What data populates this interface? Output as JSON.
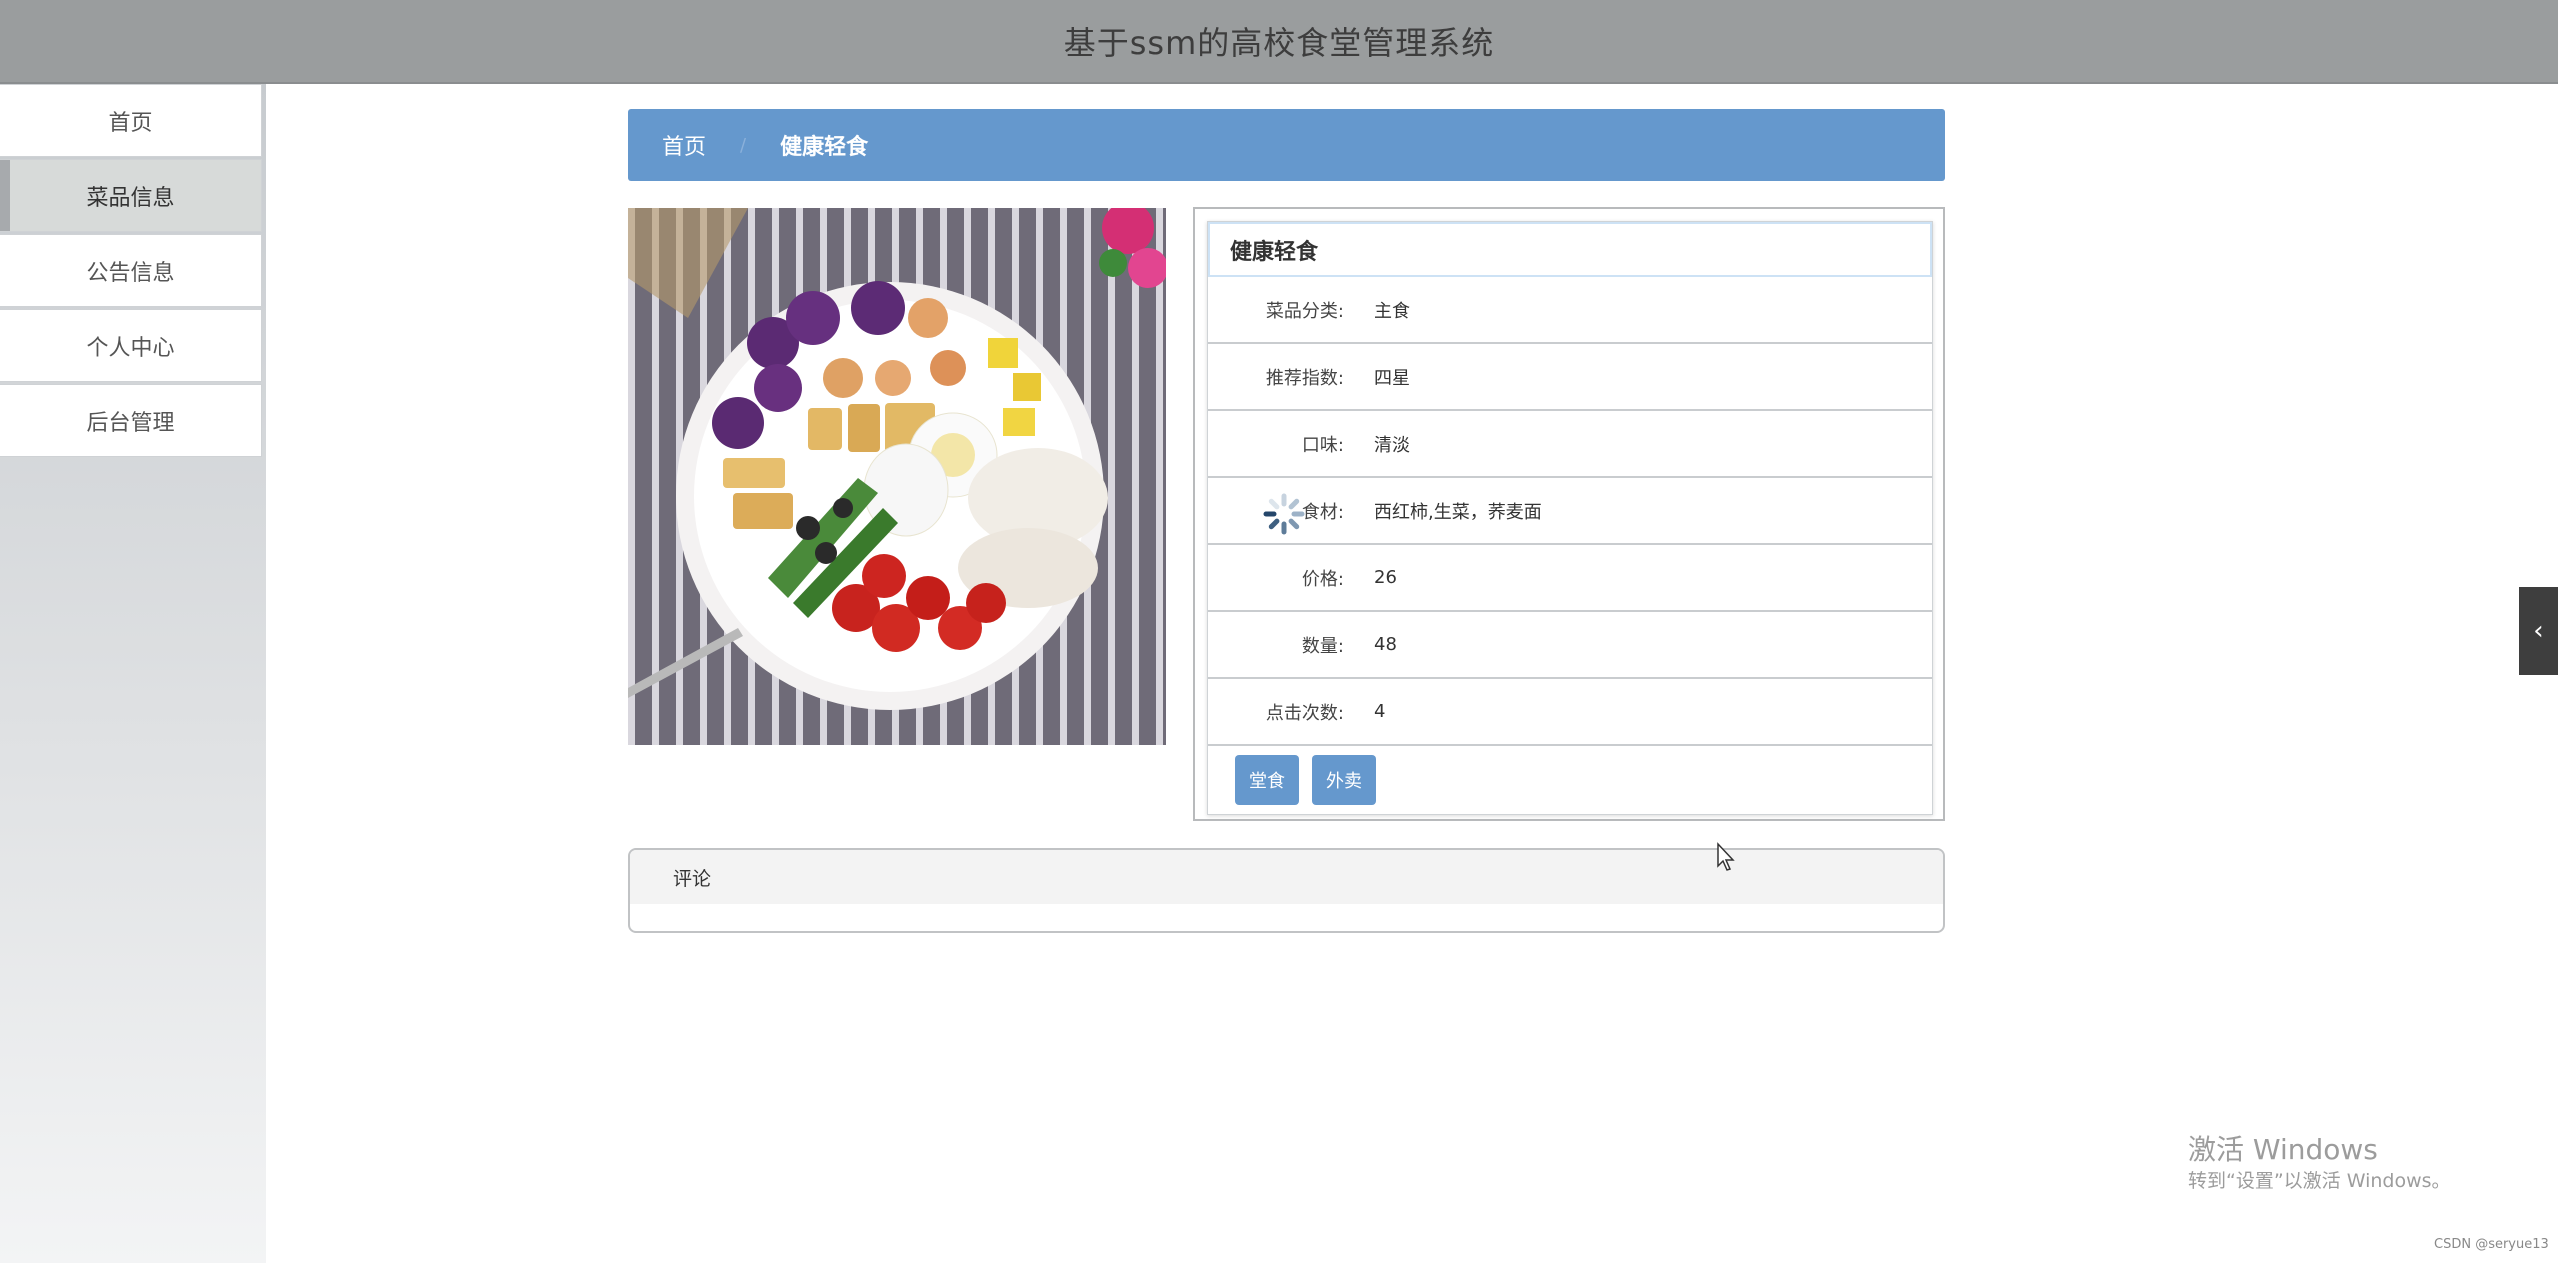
{
  "header": {
    "title": "基于ssm的高校食堂管理系统"
  },
  "sidebar": {
    "items": [
      {
        "label": "首页",
        "active": false
      },
      {
        "label": "菜品信息",
        "active": true
      },
      {
        "label": "公告信息",
        "active": false
      },
      {
        "label": "个人中心",
        "active": false
      },
      {
        "label": "后台管理",
        "active": false
      }
    ]
  },
  "breadcrumb": {
    "home": "首页",
    "separator": "/",
    "current": "健康轻食"
  },
  "detail": {
    "title": "健康轻食",
    "rows": [
      {
        "label": "菜品分类:",
        "value": "主食"
      },
      {
        "label": "推荐指数:",
        "value": "四星"
      },
      {
        "label": "口味:",
        "value": "清淡"
      },
      {
        "label": "食材:",
        "value": "西红柿,生菜，荞麦面"
      },
      {
        "label": "价格:",
        "value": "26"
      },
      {
        "label": "数量:",
        "value": "48"
      },
      {
        "label": "点击次数:",
        "value": "4"
      }
    ],
    "buttons": {
      "dine_in": "堂食",
      "takeout": "外卖"
    }
  },
  "comment": {
    "title": "评论"
  },
  "watermark": {
    "line1": "激活 Windows",
    "line2": "转到“设置”以激活 Windows。"
  },
  "footer_credit": "CSDN @seryue13",
  "colors": {
    "header_bg": "#9a9d9e",
    "accent": "#6598cd",
    "sidebar_active": "#d7dad9"
  },
  "icons": {
    "side_tab": "chevron-left-icon",
    "loading": "loading-spinner-icon"
  }
}
